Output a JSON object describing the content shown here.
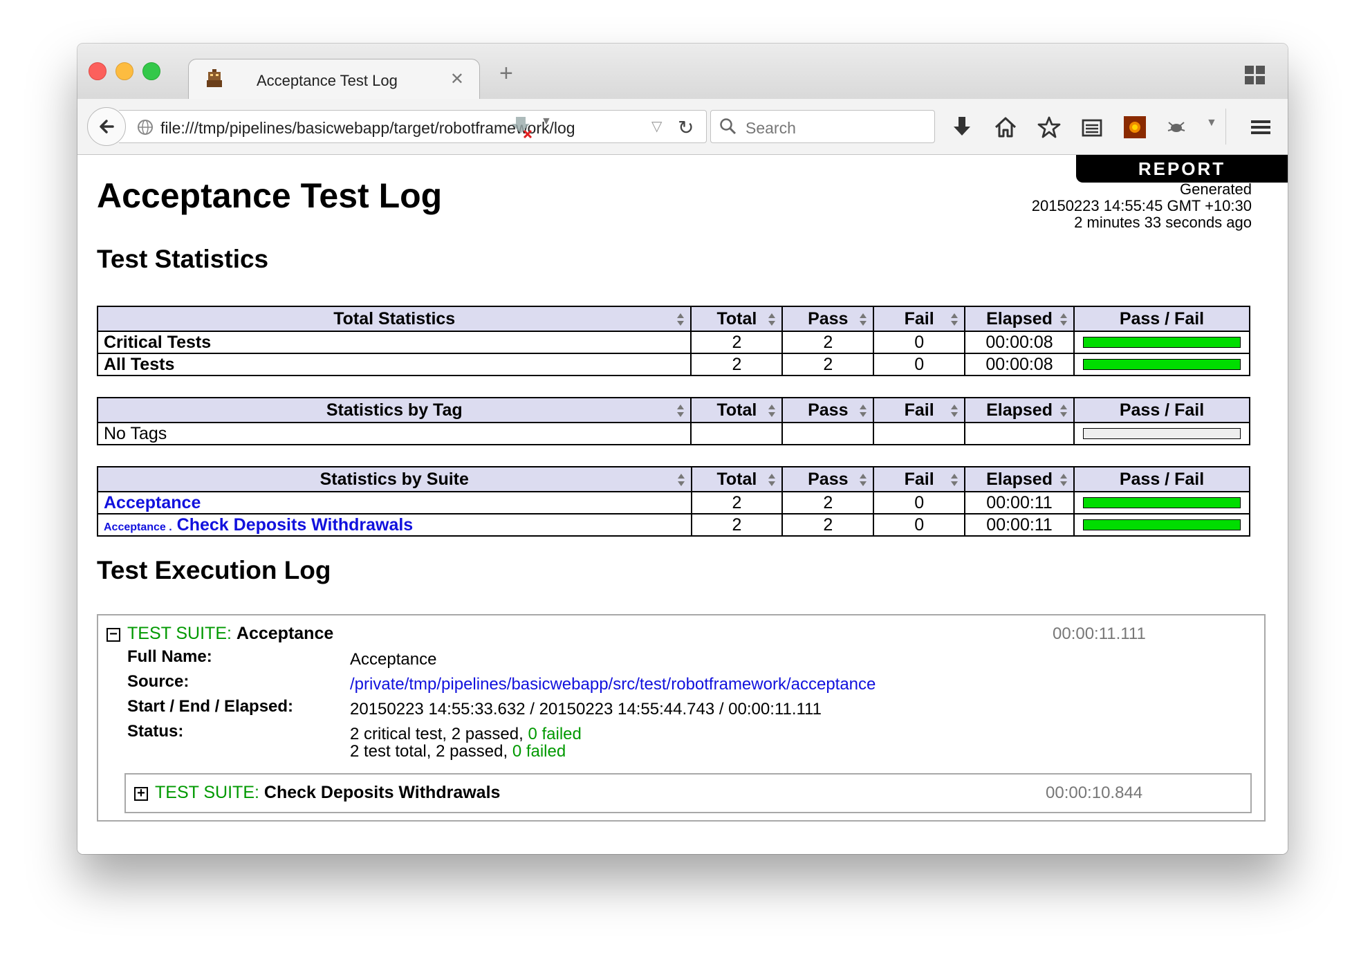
{
  "browser": {
    "tab_title": "Acceptance Test Log",
    "url": "file:///tmp/pipelines/basicwebapp/target/robotframework/log.html",
    "search_placeholder": "Search"
  },
  "page": {
    "report_label": "REPORT",
    "title": "Acceptance Test Log",
    "generated_label": "Generated",
    "generated_time": "20150223 14:55:45 GMT +10:30",
    "generated_ago": "2 minutes 33 seconds ago",
    "stats_heading": "Test Statistics",
    "log_heading": "Test Execution Log"
  },
  "columns": {
    "total": "Total",
    "pass": "Pass",
    "fail": "Fail",
    "elapsed": "Elapsed",
    "passfail": "Pass / Fail"
  },
  "total_statistics": {
    "header": "Total Statistics",
    "rows": [
      {
        "name": "Critical Tests",
        "total": "2",
        "pass": "2",
        "fail": "0",
        "elapsed": "00:00:08",
        "pass_ratio": 1.0
      },
      {
        "name": "All Tests",
        "total": "2",
        "pass": "2",
        "fail": "0",
        "elapsed": "00:00:08",
        "pass_ratio": 1.0
      }
    ]
  },
  "tag_statistics": {
    "header": "Statistics by Tag",
    "rows": [
      {
        "name": "No Tags",
        "total": "",
        "pass": "",
        "fail": "",
        "elapsed": "",
        "pass_ratio": 0
      }
    ]
  },
  "suite_statistics": {
    "header": "Statistics by Suite",
    "rows": [
      {
        "name": "Acceptance",
        "parent": "",
        "total": "2",
        "pass": "2",
        "fail": "0",
        "elapsed": "00:00:11",
        "pass_ratio": 1.0
      },
      {
        "name": "Check Deposits Withdrawals",
        "parent": "Acceptance .",
        "total": "2",
        "pass": "2",
        "fail": "0",
        "elapsed": "00:00:11",
        "pass_ratio": 1.0
      }
    ]
  },
  "execution_log": {
    "suite_keyword": "TEST SUITE:",
    "suite_name": "Acceptance",
    "suite_elapsed": "00:00:11.111",
    "full_name_label": "Full Name:",
    "full_name": "Acceptance",
    "source_label": "Source:",
    "source": "/private/tmp/pipelines/basicwebapp/src/test/robotframework/acceptance",
    "times_label": "Start / End / Elapsed:",
    "times": "20150223 14:55:33.632 / 20150223 14:55:44.743 / 00:00:11.111",
    "status_label": "Status:",
    "status_line1_prefix": "2 critical test, 2 passed,",
    "status_line1_failed": "0 failed",
    "status_line2_prefix": "2 test total, 2 passed,",
    "status_line2_failed": "0 failed",
    "child_suite_name": "Check Deposits Withdrawals",
    "child_suite_elapsed": "00:00:10.844"
  }
}
